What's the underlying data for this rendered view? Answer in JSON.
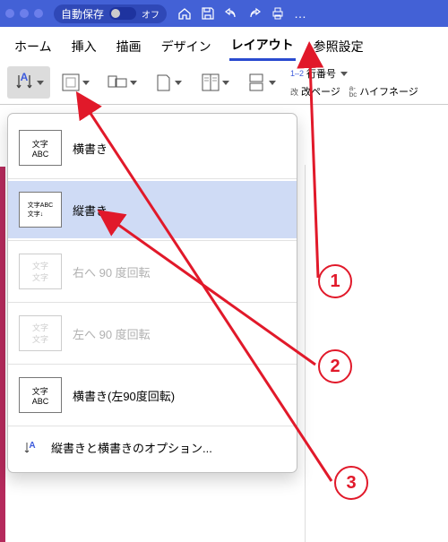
{
  "titlebar": {
    "autosave_label": "自動保存",
    "autosave_state": "オフ"
  },
  "tabs": {
    "home": "ホーム",
    "insert": "挿入",
    "draw": "描画",
    "design": "デザイン",
    "layout": "レイアウト",
    "reference": "参照設定"
  },
  "ribbon_right": {
    "line_numbers": "行番号",
    "page_break": "改ページ",
    "hyphenation": "ハイフネージ"
  },
  "dropdown": {
    "horizontal": "横書き",
    "vertical": "縦書き",
    "rotate_right": "右へ 90 度回転",
    "rotate_left": "左へ 90 度回転",
    "horizontal_left90": "横書き(左90度回転)",
    "options": "縦書きと横書きのオプション..."
  },
  "thumbs": {
    "abc": "文字\nABC",
    "abc_vert": "文字ABC\n文字↓",
    "abc_rot": "文字\n文字",
    "abc_rot2": "文字\n文字",
    "abc_rot3": "文字\nABC"
  },
  "ribbon_line_prefix": "1–2",
  "ribbon_bc_prefix": "a-\nbc",
  "annotations": {
    "n1": "1",
    "n2": "2",
    "n3": "3"
  }
}
